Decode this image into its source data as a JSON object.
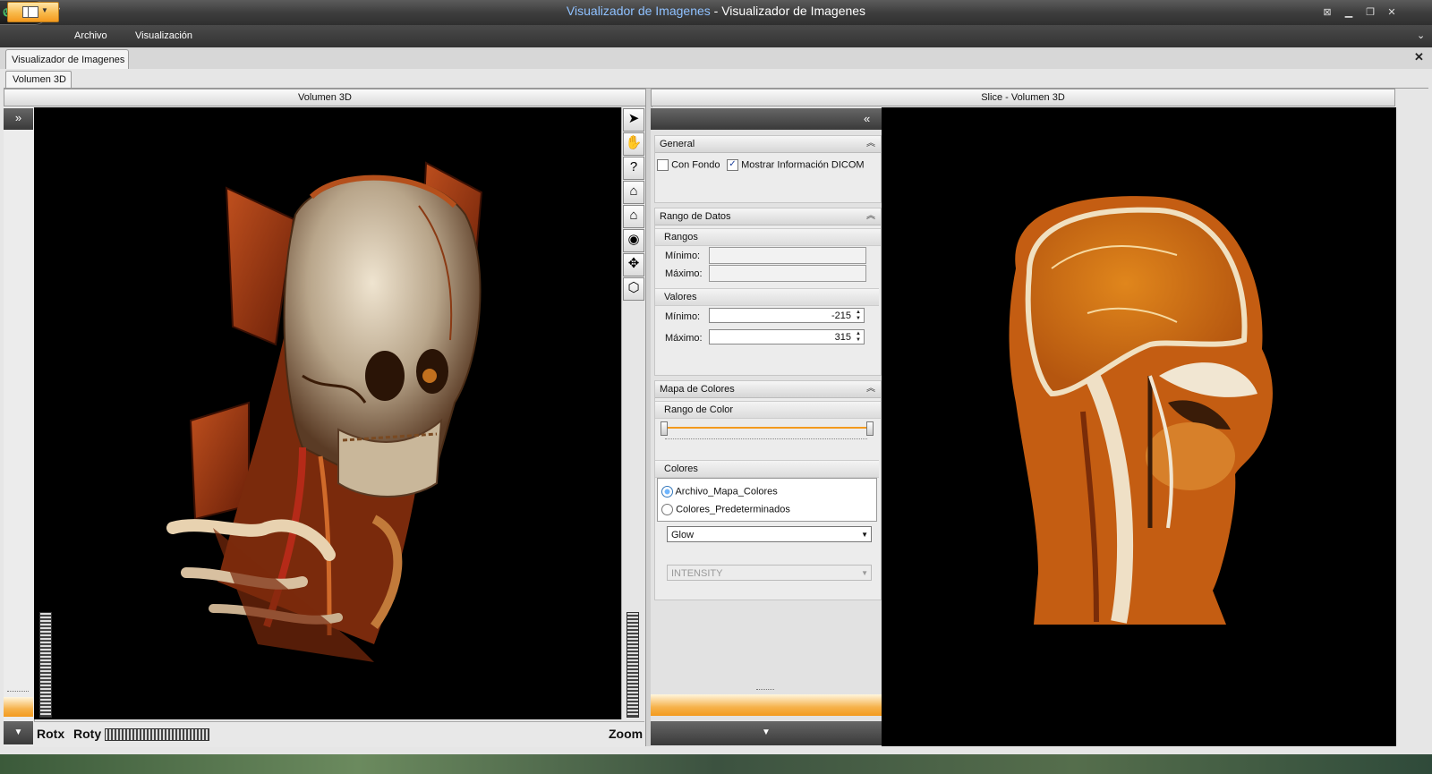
{
  "window": {
    "title_app": "Visualizador de Imagenes",
    "title_sep": " - ",
    "title_doc": "Visualizador de Imagenes"
  },
  "menu": {
    "items": [
      "Archivo",
      "Visualización"
    ]
  },
  "document_tab": {
    "label": "Visualizador de Imagenes"
  },
  "sub_tab": {
    "label": "Volumen 3D"
  },
  "left_panel": {
    "title": "Volumen 3D",
    "rot_x_label": "Rotx",
    "rot_y_label": "Roty",
    "zoom_label": "Zoom",
    "tools": [
      "select-arrow-icon",
      "hand-pan-icon",
      "help-icon",
      "home-icon",
      "home-set-icon",
      "eye-icon",
      "move-icon",
      "cube-icon"
    ]
  },
  "right_panel": {
    "title": "Slice - Volumen 3D"
  },
  "controls": {
    "general": {
      "title": "General",
      "con_fondo": {
        "label": "Con Fondo",
        "checked": false
      },
      "mostrar_dicom": {
        "label": "Mostrar Información DICOM",
        "checked": true
      }
    },
    "rango": {
      "title": "Rango de Datos",
      "rangos_title": "Rangos",
      "min_label": "Mínimo:",
      "max_label": "Máximo:",
      "min_value": "",
      "max_value": "",
      "valores_title": "Valores",
      "val_min": "-215",
      "val_max": "315"
    },
    "mapa": {
      "title": "Mapa de Colores",
      "rango_color_title": "Rango de Color",
      "colores_title": "Colores",
      "radio_archivo": "Archivo_Mapa_Colores",
      "radio_predet": "Colores_Predeterminados",
      "selected_radio": "Archivo_Mapa_Colores",
      "combo_map": "Glow",
      "combo_mode": "INTENSITY"
    }
  },
  "colors": {
    "accent": "#f39a1e",
    "title_blue": "#8fc1ff",
    "ct_orange": "#d96a12"
  }
}
